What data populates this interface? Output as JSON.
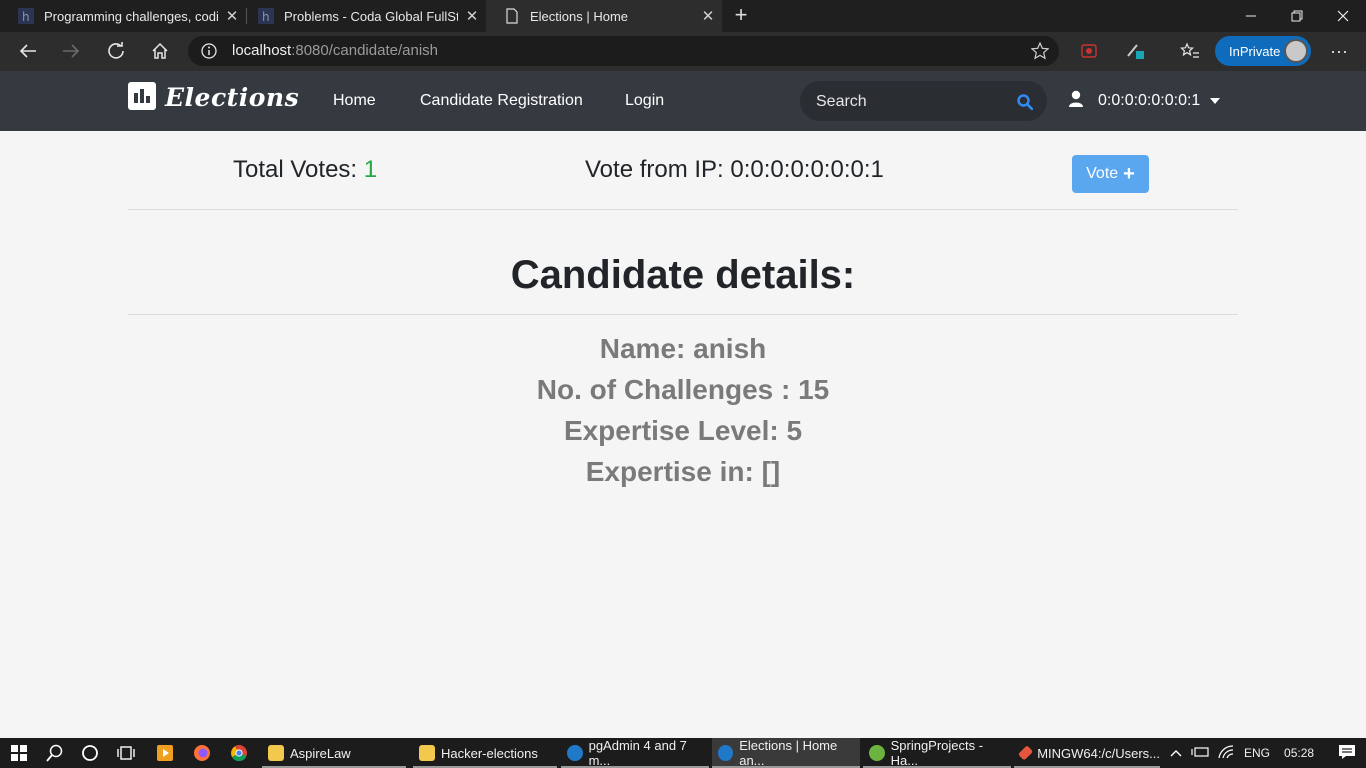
{
  "browser": {
    "tabs": [
      {
        "title": "Programming challenges, coding"
      },
      {
        "title": "Problems - Coda Global FullStack"
      },
      {
        "title": "Elections | Home"
      }
    ],
    "url_host": "localhost",
    "url_path": ":8080/candidate/anish",
    "inprivate_label": "InPrivate"
  },
  "navbar": {
    "brand": "Elections",
    "links": [
      "Home",
      "Candidate Registration",
      "Login"
    ],
    "search_placeholder": "Search",
    "user_label": "0:0:0:0:0:0:0:1"
  },
  "votes": {
    "label": "Total Votes:",
    "count": "1",
    "ip_label": "Vote from IP: 0:0:0:0:0:0:0:1",
    "button_label": "Vote"
  },
  "candidate": {
    "heading": "Candidate details:",
    "name": "Name: anish",
    "challenges": "No. of Challenges : 15",
    "expertise_level": "Expertise Level: 5",
    "expertise_in": "Expertise in: []"
  },
  "taskbar": {
    "apps": [
      "AspireLaw",
      "Hacker-elections",
      "pgAdmin 4 and 7 m...",
      "Elections | Home an...",
      "SpringProjects - Ha...",
      "MINGW64:/c/Users..."
    ],
    "language": "ENG",
    "time": "05:28"
  },
  "colors": {
    "navbar_bg": "#343a40",
    "vote_count": "#28a745",
    "vote_button": "#5aa7f0",
    "search_icon": "#2f8cf5"
  }
}
